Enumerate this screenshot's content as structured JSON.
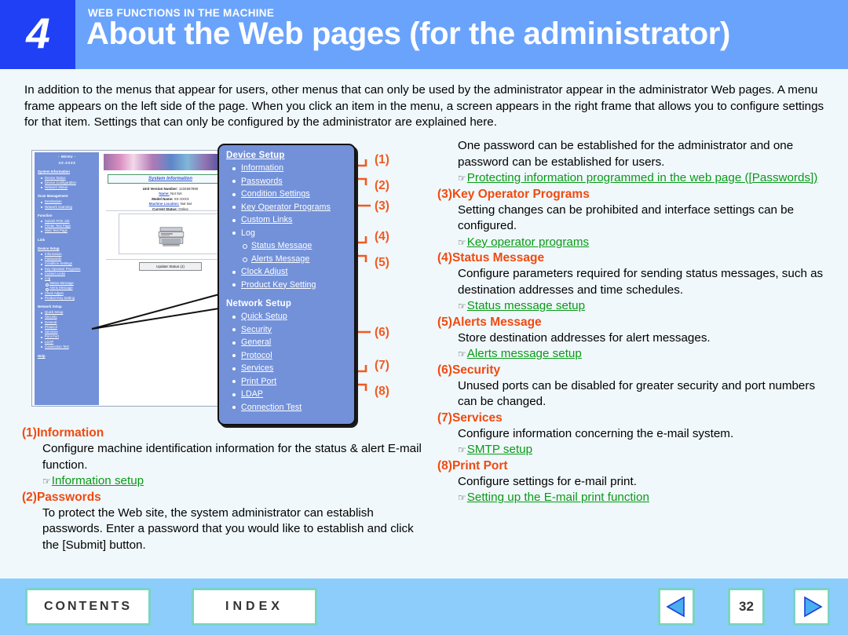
{
  "header": {
    "chapter_number": "4",
    "kicker": "WEB FUNCTIONS IN THE MACHINE",
    "title": "About the Web pages (for the administrator)"
  },
  "intro": "In addition to the menus that appear for users, other menus that can only be used by the administrator appear in the administrator Web pages. A menu frame appears on the left side of the page. When you click an item in the menu, a screen appears in the right frame that allows you to configure settings for that item. Settings that can only be configured by the administrator are explained here.",
  "browser": {
    "menu_title": "- MENU -",
    "model": "XX-XXXX",
    "groups": [
      {
        "label": "System Information",
        "items": [
          "Device Status",
          "Device Configuration",
          "Network Status"
        ]
      },
      {
        "label": "Scan Management",
        "items": [
          "Destination",
          "Network Scanning"
        ]
      },
      {
        "label": "Function",
        "items": [
          "Submit Print Job",
          "Printer Test Page",
          "Web Test Page"
        ]
      },
      {
        "label": "Link",
        "items": []
      },
      {
        "label": "Device Setup",
        "items": [
          "Information",
          "Passwords",
          "Condition Settings",
          "Key Operator Programs",
          "Custom Links",
          "Log"
        ]
      },
      {
        "label": "Network Setup",
        "items": [
          "Quick Setup",
          "Security",
          "General",
          "Protocol",
          "Services",
          "Print Port",
          "LDAP",
          "Connection Test"
        ]
      }
    ],
    "log_subitems": [
      "Status Message",
      "Alerts Message"
    ],
    "after_log_items": [
      "Clock Adjust",
      "Product Key Setting"
    ],
    "help_label": "Help",
    "panel_title": "System Information",
    "fields": [
      {
        "label": "Unit Version Number:",
        "value": "1234567890",
        "link": false
      },
      {
        "label": "Name:",
        "value": "Not Set",
        "link": true
      },
      {
        "label": "Model Name:",
        "value": "XX-XXXX",
        "link": false
      },
      {
        "label": "Machine Location:",
        "value": "Not Set",
        "link": true
      },
      {
        "label": "Current Status:",
        "value": "Online",
        "link": false
      }
    ],
    "update_button": "Update Status (J)"
  },
  "zoom_panel": {
    "device_setup": {
      "title": "Device Setup",
      "items": [
        {
          "label": "Information",
          "link": true,
          "sub": false
        },
        {
          "label": "Passwords",
          "link": true,
          "sub": false
        },
        {
          "label": "Condition Settings",
          "link": true,
          "sub": false
        },
        {
          "label": "Key Operator Programs",
          "link": true,
          "sub": false
        },
        {
          "label": "Custom Links",
          "link": true,
          "sub": false
        },
        {
          "label": "Log",
          "link": false,
          "sub": false
        },
        {
          "label": "Status Message",
          "link": true,
          "sub": true
        },
        {
          "label": "Alerts Message",
          "link": true,
          "sub": true
        },
        {
          "label": "Clock Adjust",
          "link": true,
          "sub": false
        },
        {
          "label": "Product Key Setting",
          "link": true,
          "sub": false
        }
      ]
    },
    "network_setup": {
      "title": "Network Setup",
      "items": [
        {
          "label": "Quick Setup",
          "link": true,
          "sub": false
        },
        {
          "label": "Security",
          "link": true,
          "sub": false
        },
        {
          "label": "General",
          "link": true,
          "sub": false
        },
        {
          "label": "Protocol",
          "link": true,
          "sub": false
        },
        {
          "label": "Services",
          "link": true,
          "sub": false
        },
        {
          "label": "Print Port",
          "link": true,
          "sub": false
        },
        {
          "label": "LDAP",
          "link": true,
          "sub": false
        },
        {
          "label": "Connection Test",
          "link": true,
          "sub": false
        }
      ]
    }
  },
  "callouts": {
    "n1": "(1)",
    "n2": "(2)",
    "n3": "(3)",
    "n4": "(4)",
    "n5": "(5)",
    "n6": "(6)",
    "n7": "(7)",
    "n8": "(8)"
  },
  "sections": {
    "s1": {
      "number": "(1)",
      "heading": "Information",
      "body": "Configure machine identification information for the status & alert E-mail function.",
      "link": "Information setup"
    },
    "s2": {
      "number": "(2)",
      "heading": "Passwords",
      "body": "To protect the Web site, the system administrator can establish passwords. Enter a password that you would like to establish and click the [Submit] button."
    },
    "s2_cont": {
      "body": "One password can be established for the administrator and one password can be established for users.",
      "link": "Protecting information programmed in the web page ([Passwords])"
    },
    "s3": {
      "number": "(3)",
      "heading": "Key Operator Programs",
      "body": "Setting changes can be prohibited and interface settings can be configured.",
      "link": "Key operator programs"
    },
    "s4": {
      "number": "(4)",
      "heading": "Status Message",
      "body": "Configure parameters required for sending status messages, such as destination addresses and time schedules.",
      "link": "Status message setup"
    },
    "s5": {
      "number": "(5)",
      "heading": "Alerts Message",
      "body": "Store destination addresses for alert messages.",
      "link": "Alerts message setup"
    },
    "s6": {
      "number": "(6)",
      "heading": "Security",
      "body": "Unused ports can be disabled for greater security and port numbers can be changed."
    },
    "s7": {
      "number": "(7)",
      "heading": "Services",
      "body": "Configure information concerning the e-mail system.",
      "link": "SMTP setup"
    },
    "s8": {
      "number": "(8)",
      "heading": "Print Port",
      "body": "Configure settings for e-mail print.",
      "link": "Setting up the E-mail print function"
    }
  },
  "footer": {
    "contents": "CONTENTS",
    "index": "INDEX",
    "page_number": "32"
  },
  "colors": {
    "chapter_box": "#2040f5",
    "header_band": "#6aa3fb",
    "page_bg": "#f0f8fb",
    "heading_orange": "#f04a10",
    "link_green": "#0a9a18",
    "callout_orange": "#f05a22",
    "footer_band": "#8ccdfc",
    "footer_button_border": "#7bd4c4",
    "menu_blue": "#7391d9"
  }
}
